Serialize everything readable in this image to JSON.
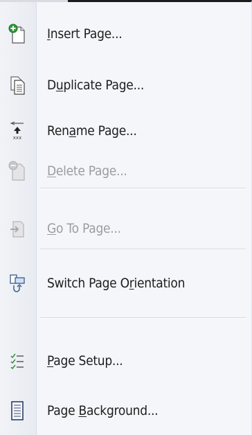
{
  "menu": {
    "items": [
      {
        "pre": "",
        "u": "I",
        "post": "nsert Page...",
        "icon": "insert-page-icon",
        "enabled": true
      },
      {
        "pre": "D",
        "u": "u",
        "post": "plicate Page...",
        "icon": "duplicate-page-icon",
        "enabled": true
      },
      {
        "pre": "Ren",
        "u": "a",
        "post": "me Page...",
        "icon": "rename-page-icon",
        "enabled": true
      },
      {
        "pre": "",
        "u": "D",
        "post": "elete Page...",
        "icon": "delete-page-icon",
        "enabled": false
      },
      {
        "pre": "",
        "u": "G",
        "post": "o To Page...",
        "icon": "go-to-page-icon",
        "enabled": false
      },
      {
        "pre": "Switch Page O",
        "u": "r",
        "post": "ientation",
        "icon": "switch-orientation-icon",
        "enabled": true
      },
      {
        "pre": "",
        "u": "P",
        "post": "age Setup...",
        "icon": "page-setup-icon",
        "enabled": true
      },
      {
        "pre": "Page ",
        "u": "B",
        "post": "ackground...",
        "icon": "page-background-icon",
        "enabled": true
      }
    ]
  },
  "colors": {
    "text": "#1d1d1d",
    "disabled_text": "#9a9ca2",
    "menu_background": "#f4f6fa",
    "separator": "#d6d8de"
  }
}
